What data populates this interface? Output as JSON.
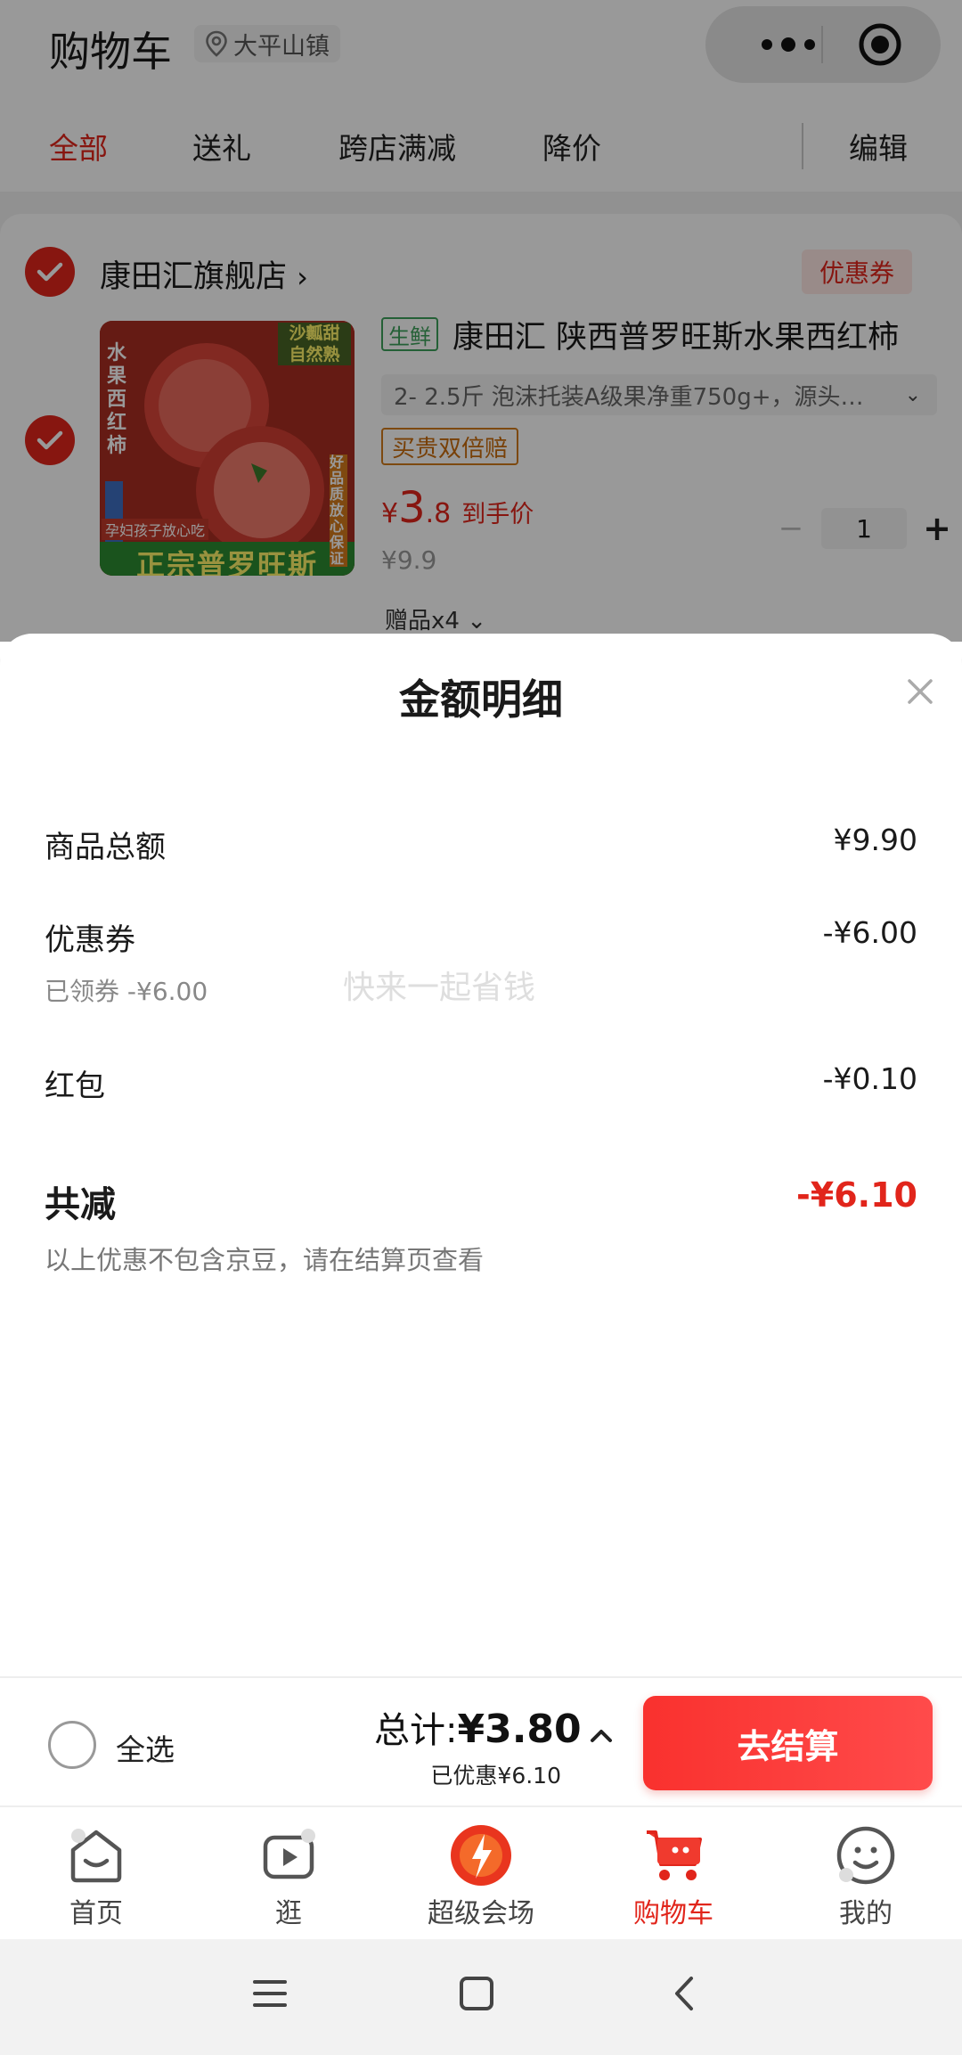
{
  "header": {
    "title": "购物车",
    "location": "大平山镇",
    "more_icon": "more-dots-icon",
    "capsule_icon": "target-icon"
  },
  "tabs": [
    {
      "label": "全部",
      "active": true
    },
    {
      "label": "送礼",
      "active": false
    },
    {
      "label": "跨店满减",
      "active": false
    },
    {
      "label": "降价",
      "active": false
    }
  ],
  "edit_label": "编辑",
  "store": {
    "name": "康田汇旗舰店",
    "chevron": "›",
    "coupon_label": "优惠券",
    "checked": true
  },
  "product": {
    "tag": "生鲜",
    "name": "康田汇 陕西普罗旺斯水果西红柿",
    "spec": "2- 2.5斤 泡沫托装A级果净重750g+，源头…",
    "guarantee": "买贵双倍赔",
    "price_currency": "¥",
    "price_int": "3",
    "price_dec": ".8",
    "price_label": "到手价",
    "original_price": "¥9.9",
    "quantity": "1",
    "gift": "赠品x4",
    "thumb_texts": {
      "top_right": "沙瓤甜\n自然熟",
      "left": "水果西红柿",
      "right": "好品质放心保证",
      "bottom_small": "孕妇孩子放心吃",
      "bottom": "正宗普罗旺斯"
    }
  },
  "sheet": {
    "title": "金额明细",
    "rows": [
      {
        "label": "商品总额",
        "value": "¥9.90"
      },
      {
        "label": "优惠券",
        "value": "-¥6.00",
        "sub": "已领券 -¥6.00"
      },
      {
        "label": "红包",
        "value": "-¥0.10"
      }
    ],
    "watermark": "快来一起省钱",
    "total_label": "共减",
    "total_value": "-¥6.10",
    "note": "以上优惠不包含京豆，请在结算页查看"
  },
  "checkout": {
    "select_all": "全选",
    "total_prefix": "总计:",
    "total_value": "¥3.80",
    "saved": "已优惠¥6.10",
    "pay_button": "去结算"
  },
  "tabbar": [
    {
      "label": "首页",
      "icon": "home-icon",
      "active": false
    },
    {
      "label": "逛",
      "icon": "video-play-icon",
      "active": false
    },
    {
      "label": "超级会场",
      "icon": "super-venue-icon",
      "active": false
    },
    {
      "label": "购物车",
      "icon": "cart-icon",
      "active": true
    },
    {
      "label": "我的",
      "icon": "profile-smile-icon",
      "active": false
    }
  ],
  "colors": {
    "accent": "#e1251b",
    "fresh_green": "#3da05a",
    "guarantee_orange": "#c86c0c"
  }
}
